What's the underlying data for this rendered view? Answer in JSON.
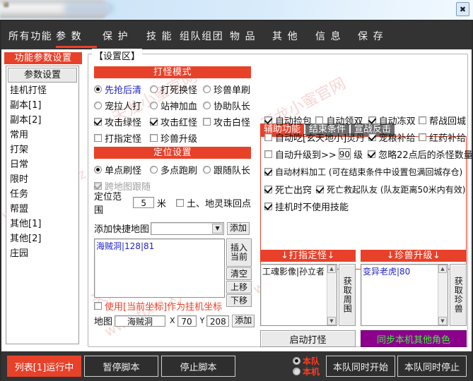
{
  "window": {
    "close_label": "✖",
    "watermarks": [
      "天龙小蜜官网",
      "www.tlxm.xyz"
    ]
  },
  "nav": {
    "items": [
      {
        "label": "所有功能",
        "active": false
      },
      {
        "label": "参  数",
        "active": true
      },
      {
        "label": "保  护",
        "active": false
      },
      {
        "label": "技  能",
        "active": false
      },
      {
        "label": "组队组团",
        "active": false
      },
      {
        "label": "物  品",
        "active": false
      },
      {
        "label": "其  他",
        "active": false
      },
      {
        "label": "信  息",
        "active": false
      },
      {
        "label": "保  存",
        "active": false
      }
    ]
  },
  "sidebar": {
    "title": "功能参数设置",
    "button": "参数设置",
    "items": [
      {
        "label": "挂机打怪"
      },
      {
        "label": "副本[1]"
      },
      {
        "label": "副本[2]"
      },
      {
        "label": "常用"
      },
      {
        "label": "打架"
      },
      {
        "label": "日常"
      },
      {
        "label": "限时"
      },
      {
        "label": "任务"
      },
      {
        "label": "帮盟"
      },
      {
        "label": "其他[1]"
      },
      {
        "label": "其他[2]"
      },
      {
        "label": "庄园"
      }
    ]
  },
  "settings_group": {
    "label": "【设置区】"
  },
  "monster_mode": {
    "title": "打怪模式",
    "rows": [
      [
        {
          "type": "radio",
          "checked": true,
          "label": "先抢后清",
          "style": "blue"
        },
        {
          "type": "radio",
          "checked": false,
          "label": "打死换怪",
          "style": "normal"
        },
        {
          "type": "radio",
          "checked": false,
          "label": "珍兽单刷",
          "style": "normal"
        }
      ],
      [
        {
          "type": "radio",
          "checked": false,
          "label": "宠拉人打",
          "style": "normal"
        },
        {
          "type": "radio",
          "checked": false,
          "label": "站神加血",
          "style": "normal"
        },
        {
          "type": "radio",
          "checked": false,
          "label": "协助队长",
          "style": "normal"
        }
      ],
      [
        {
          "type": "check",
          "checked": true,
          "label": "攻击绿怪",
          "style": "normal"
        },
        {
          "type": "check",
          "checked": true,
          "label": "攻击红怪",
          "style": "normal"
        },
        {
          "type": "check",
          "checked": false,
          "label": "攻击白怪",
          "style": "normal"
        }
      ],
      [
        {
          "type": "check",
          "checked": false,
          "label": "打指定怪",
          "style": "normal"
        },
        {
          "type": "check",
          "checked": false,
          "label": "珍兽升级",
          "style": "normal"
        }
      ]
    ]
  },
  "position_settings": {
    "title": "定位设置",
    "mode_row": [
      {
        "type": "radio",
        "checked": true,
        "label": "单点刷怪"
      },
      {
        "type": "radio",
        "checked": false,
        "label": "多点跑刷"
      },
      {
        "type": "radio",
        "checked": false,
        "label": "跟随队长"
      }
    ],
    "cross_map": {
      "checked": true,
      "disabled": true,
      "label": "跨地图跟随"
    },
    "range_label": "定位范围",
    "range_value": "5",
    "range_unit": "米",
    "pearl_return": {
      "checked": false,
      "label": "土、地灵珠回点"
    },
    "quick_map_label": "添加快捷地图",
    "quick_map_value": "",
    "quick_map_add": "添加",
    "map_list": [
      "海贼洞|128|81"
    ],
    "side_buttons": [
      "插入\n当前",
      "清空",
      "上移",
      "下移"
    ],
    "use_current_coord": {
      "checked": false,
      "label": "使用[当前坐标]作为挂机坐标"
    },
    "map_row": {
      "label": "地图",
      "map_value": "海贼洞",
      "x_label": "X",
      "x_value": "70",
      "y_label": "Y",
      "y_value": "208",
      "add_label": "添加"
    }
  },
  "right_panel": {
    "tabs": [
      {
        "label": "辅助功能",
        "active": true
      },
      {
        "label": "结束条件",
        "active": false
      },
      {
        "label": "宣战反击",
        "active": false
      }
    ],
    "rows": [
      [
        {
          "checked": true,
          "label": "自动捡包"
        },
        {
          "checked": false,
          "label": "自动领双"
        },
        {
          "checked": true,
          "label": "自动冻双"
        },
        {
          "checked": false,
          "label": "帮战回城"
        }
      ],
      [
        {
          "checked": false,
          "label": "自动吃[玄天地小]灵丹"
        },
        {
          "checked": true,
          "label": "宠粮补给"
        },
        {
          "checked": false,
          "label": "红药补给"
        }
      ],
      [
        {
          "checked": true,
          "label": "自动材料加工 (可在结束条件中设置包满回城存仓)"
        }
      ],
      [
        {
          "checked": true,
          "label": "死亡出窍"
        },
        {
          "checked": true,
          "label": "死亡救起队友 (队友距离50米内有效)"
        }
      ],
      [
        {
          "checked": true,
          "label": "挂机时不使用技能"
        }
      ]
    ],
    "levelup": {
      "checked": false,
      "label": "自动升级到>>",
      "value": "90",
      "suffix": "级"
    },
    "ignore_kill": {
      "checked": true,
      "label": "忽略22点后的杀怪数量"
    }
  },
  "target_monster": {
    "title": "↓打指定怪↓",
    "items": [
      "工魂影像|孙立者"
    ],
    "side_button": "获取周围",
    "action_button": "启动打怪"
  },
  "pet_upgrade": {
    "title": "↓珍兽升级↓",
    "items": [
      "变异老虎|80"
    ],
    "side_button": "获取珍兽",
    "action_button": "同步本机其他角色"
  },
  "bottom_bar": {
    "status_button": "列表[1]运行中",
    "pause_button": "暂停脚本",
    "stop_button": "停止脚本",
    "scope": [
      {
        "label": "本队",
        "checked": true
      },
      {
        "label": "本机",
        "checked": false
      }
    ],
    "team_start": "本队同时开始",
    "team_stop": "本队同时停止"
  }
}
